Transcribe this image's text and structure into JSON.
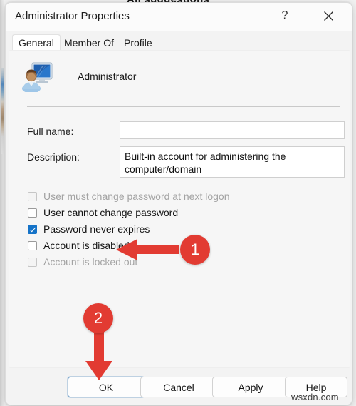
{
  "background_window": {
    "title": "All suggestions"
  },
  "dialog": {
    "title": "Administrator Properties",
    "titlebar_buttons": {
      "help_label": "?",
      "help_icon": "question-mark-icon",
      "close_icon": "close-icon"
    },
    "tabs": [
      {
        "label": "General",
        "active": true
      },
      {
        "label": "Member Of",
        "active": false
      },
      {
        "label": "Profile",
        "active": false
      }
    ],
    "account": {
      "icon": "user-computer-icon",
      "name": "Administrator"
    },
    "fields": [
      {
        "label": "Full name:",
        "value": "",
        "placeholder": ""
      },
      {
        "label": "Description:",
        "value": "Built-in account for administering the computer/domain",
        "placeholder": ""
      }
    ],
    "checkboxes": [
      {
        "label": "User must change password at next logon",
        "checked": false,
        "disabled": true
      },
      {
        "label": "User cannot change password",
        "checked": false,
        "disabled": false
      },
      {
        "label": "Password never expires",
        "checked": true,
        "disabled": false
      },
      {
        "label": "Account is disabled",
        "checked": false,
        "disabled": false
      },
      {
        "label": "Account is locked out",
        "checked": false,
        "disabled": true
      }
    ],
    "buttons": [
      {
        "label": "OK",
        "default": true
      },
      {
        "label": "Cancel",
        "default": false
      },
      {
        "label": "Apply",
        "default": false
      },
      {
        "label": "Help",
        "default": false
      }
    ]
  },
  "annotations": {
    "color": "#e23b32",
    "step_one": {
      "number": "1",
      "arrow": "arrow-left-icon",
      "points_at": "Account is disabled"
    },
    "step_two": {
      "number": "2",
      "arrow": "arrow-down-icon",
      "points_at": "OK"
    }
  },
  "watermark": {
    "text": "wsxdn.com"
  }
}
